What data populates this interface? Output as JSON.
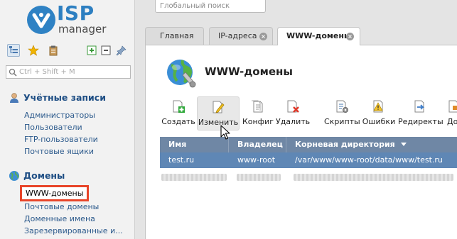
{
  "brand": {
    "name": "ISP",
    "product": "manager"
  },
  "search": {
    "placeholder": "Глобальный поиск"
  },
  "filter": {
    "placeholder": "Ctrl + Shift + M"
  },
  "tabs": [
    {
      "label": "Главная",
      "closable": false,
      "active": false
    },
    {
      "label": "IP-адреса",
      "closable": true,
      "active": false
    },
    {
      "label": "WWW-домены",
      "closable": true,
      "active": true
    }
  ],
  "sidebar": {
    "sections": [
      {
        "title": "Учётные записи",
        "icon": "user-accounts-icon",
        "items": [
          "Администраторы",
          "Пользователи",
          "FTP-пользователи",
          "Почтовые ящики"
        ]
      },
      {
        "title": "Домены",
        "icon": "globe-icon",
        "items": [
          "WWW-домены",
          "Почтовые домены",
          "Доменные имена",
          "Зарезервированные и..."
        ],
        "selected_index": 0
      }
    ]
  },
  "page": {
    "title": "WWW-домены"
  },
  "toolbar": {
    "buttons": [
      {
        "label": "Создать",
        "icon": "create-icon"
      },
      {
        "label": "Изменить",
        "icon": "edit-icon",
        "hovered": true
      },
      {
        "label": "Конфиг",
        "icon": "config-icon"
      },
      {
        "label": "Удалить",
        "icon": "delete-icon"
      },
      {
        "label": "Скрипты",
        "icon": "scripts-icon"
      },
      {
        "label": "Ошибки",
        "icon": "errors-icon"
      },
      {
        "label": "Редиректы",
        "icon": "redirects-icon"
      },
      {
        "label": "До",
        "icon": "more-icon"
      }
    ]
  },
  "table": {
    "columns": [
      "Имя",
      "Владелец",
      "Корневая директория"
    ],
    "sort_column": 2,
    "rows": [
      {
        "name": "test.ru",
        "owner": "www-root",
        "root": "/var/www/www-root/data/www/test.ru",
        "selected": true
      }
    ]
  },
  "colors": {
    "accent": "#2d7fc1",
    "header": "#6f87a5",
    "selected_row": "#5f87b5",
    "highlight_box": "#e8452a"
  }
}
